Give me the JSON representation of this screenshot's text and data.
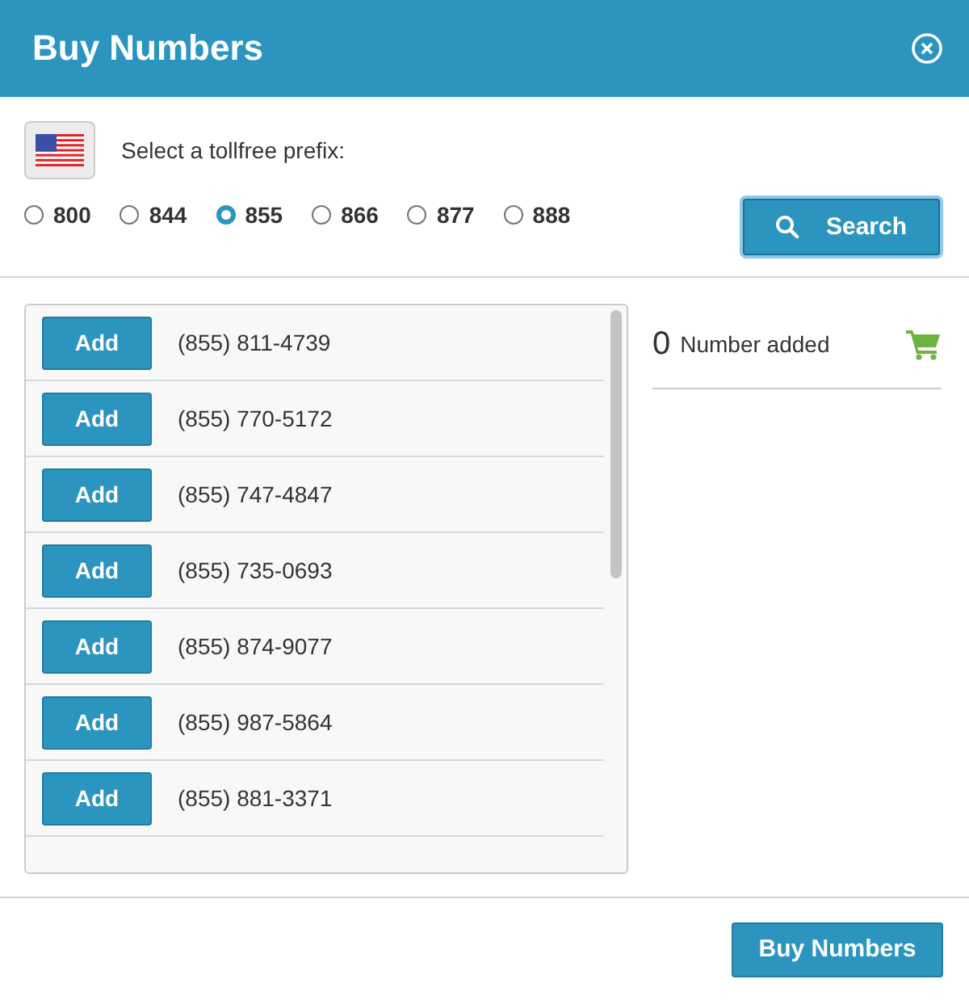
{
  "dialog": {
    "title": "Buy Numbers"
  },
  "prefix": {
    "label": "Select a tollfree prefix:",
    "options": [
      {
        "label": "800",
        "selected": false
      },
      {
        "label": "844",
        "selected": false
      },
      {
        "label": "855",
        "selected": true
      },
      {
        "label": "866",
        "selected": false
      },
      {
        "label": "877",
        "selected": false
      },
      {
        "label": "888",
        "selected": false
      }
    ]
  },
  "search_button": "Search",
  "numbers": [
    {
      "button": "Add",
      "number": "(855) 811-4739"
    },
    {
      "button": "Add",
      "number": "(855) 770-5172"
    },
    {
      "button": "Add",
      "number": "(855) 747-4847"
    },
    {
      "button": "Add",
      "number": "(855) 735-0693"
    },
    {
      "button": "Add",
      "number": "(855) 874-9077"
    },
    {
      "button": "Add",
      "number": "(855) 987-5864"
    },
    {
      "button": "Add",
      "number": "(855) 881-3371"
    }
  ],
  "cart": {
    "count": "0",
    "label": "Number added"
  },
  "footer_button": "Buy Numbers"
}
